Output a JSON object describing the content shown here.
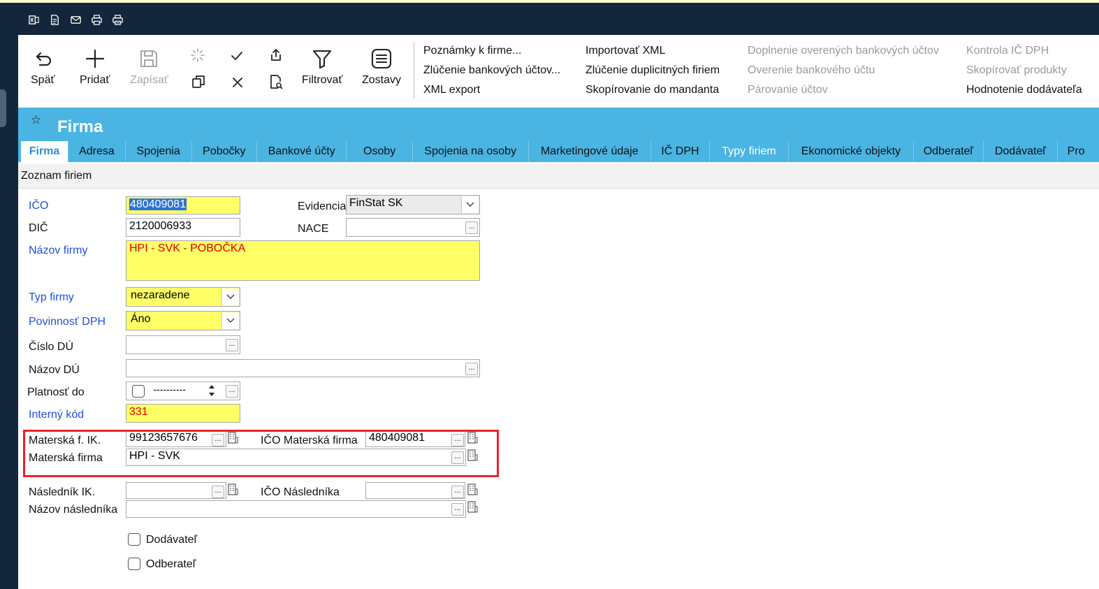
{
  "quick_toolbar": {
    "icons": [
      "excel-export-icon",
      "document-icon",
      "mail-icon",
      "print-icon",
      "print-preview-icon"
    ]
  },
  "ribbon": {
    "back_label": "Späť",
    "add_label": "Pridať",
    "save_label": "Zapísať",
    "filter_label": "Filtrovať",
    "reports_label": "Zostavy",
    "links": {
      "notes": "Poznámky k firme...",
      "merge_bank": "Zlúčenie bankových účtov...",
      "xml_export": "XML export",
      "import_xml": "Importovať XML",
      "merge_duplicates": "Zlúčenie duplicitných firiem",
      "copy_mandant": "Skopírovanie do mandanta",
      "fill_bank": "Doplnenie overených bankových účtov",
      "verify_bank": "Overenie bankového účtu",
      "pair_accounts": "Párovanie účtov",
      "check_vat": "Kontrola IČ DPH",
      "copy_products": "Skopírovať produkty",
      "rate_supplier": "Hodnotenie dodávateľa"
    }
  },
  "form_title": "Firma",
  "tabs": [
    "Firma",
    "Adresa",
    "Spojenia",
    "Pobočky",
    "Bankové účty",
    "Osoby",
    "Spojenia na osoby",
    "Marketingové údaje",
    "IČ DPH",
    "Typy firiem",
    "Ekonomické objekty",
    "Odberateľ",
    "Dodávateľ",
    "Pro"
  ],
  "list_title": "Zoznam firiem",
  "fields": {
    "ico": {
      "label": "IČO",
      "value": "480409081"
    },
    "dic": {
      "label": "DIČ",
      "value": "2120006933"
    },
    "evidencia": {
      "label": "Evidencia",
      "value": "FinStat SK"
    },
    "nace": {
      "label": "NACE",
      "value": ""
    },
    "nazov_firmy": {
      "label": "Názov firmy",
      "value": "HPI - SVK - POBOČKA"
    },
    "typ_firmy": {
      "label": "Typ firmy",
      "value": "nezaradene"
    },
    "povinnost_dph": {
      "label": "Povinnosť DPH",
      "value": "Áno"
    },
    "cislo_du": {
      "label": "Číslo DÚ",
      "value": ""
    },
    "nazov_du": {
      "label": "Názov DÚ",
      "value": ""
    },
    "platnost_do": {
      "label": "Platnosť do",
      "value": "----------"
    },
    "interny_kod": {
      "label": "Interný kód",
      "value": "331"
    },
    "materska_ik": {
      "label": "Materská f. IK.",
      "value": "99123657676"
    },
    "ico_materska": {
      "label": "IČO Materská firma",
      "value": "480409081"
    },
    "materska_firma": {
      "label": "Materská firma",
      "value": "HPI - SVK"
    },
    "naslednik_ik": {
      "label": "Následník IK.",
      "value": ""
    },
    "ico_naslednika": {
      "label": "IČO Následníka",
      "value": ""
    },
    "nazov_naslednika": {
      "label": "Názov následníka",
      "value": ""
    }
  },
  "checkboxes": {
    "dodavatel": "Dodávateľ",
    "odberatel": "Odberateľ"
  },
  "dots_label": "...",
  "colors": {
    "accent": "#4ab4e3",
    "dark": "#13263c",
    "required_field": "#ffff66",
    "required_label": "#1f4fe0",
    "highlight_border": "#e8232a"
  }
}
